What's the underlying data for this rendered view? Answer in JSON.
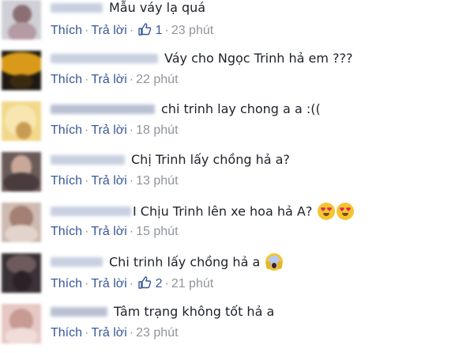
{
  "actions": {
    "like": "Thích",
    "reply": "Trả lời"
  },
  "comments": [
    {
      "text": "Mẫu váy lạ quá",
      "likes": "1",
      "time": "23 phút"
    },
    {
      "text": "Váy cho Ngọc Trinh hả em ???",
      "likes": "",
      "time": "22 phút"
    },
    {
      "text": "chi trinh lay chong a a :((",
      "likes": "",
      "time": "18 phút"
    },
    {
      "text": "Chị Trinh lấy chồng hả a?",
      "likes": "",
      "time": "13 phút"
    },
    {
      "text": "I Chịu Trinh lên xe hoa hả A?",
      "likes": "",
      "time": "15 phút"
    },
    {
      "text": "Chi trinh lấy chồng hả a",
      "likes": "2",
      "time": "21 phút"
    },
    {
      "text": "Tâm trạng không tốt hả a",
      "likes": "",
      "time": "23 phút"
    }
  ],
  "colors": {
    "link": "#385898",
    "meta": "#90949c",
    "text": "#1d2129"
  },
  "icons": {
    "like": "thumbs-up-icon",
    "heart_eyes": "heart-eyes-emoji",
    "scream": "scream-emoji"
  }
}
